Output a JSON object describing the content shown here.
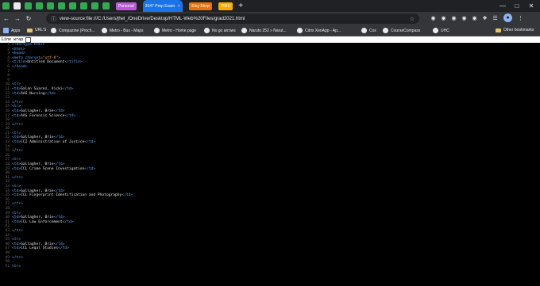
{
  "tabs": [
    {
      "label": "",
      "color": "#34a853"
    },
    {
      "label": "",
      "color": "#e8eaed"
    },
    {
      "label": "",
      "color": "#34a853"
    },
    {
      "label": "",
      "color": "#34a853"
    },
    {
      "label": "",
      "color": "#34a853"
    },
    {
      "label": "",
      "color": "#34a853"
    },
    {
      "label": "",
      "color": "#34a853"
    },
    {
      "label": "",
      "color": "#34a853"
    },
    {
      "label": "",
      "color": "#34a853"
    },
    {
      "label": "",
      "color": "#34a853"
    }
  ],
  "colored_tabs": [
    {
      "label": "Personal",
      "bg": "#b85cd6",
      "active": false
    },
    {
      "label": "3147 Prep Exam",
      "bg": "#1a73e8",
      "active": true
    },
    {
      "label": "Etsy Shop",
      "bg": "#e8710a",
      "active": false
    },
    {
      "label": "TIMU",
      "bg": "#f9ab00",
      "active": false
    }
  ],
  "address": {
    "url": "view-source:file:///C:/Users/jhel_/OneDrive/Desktop/HTML-Web%20Files/grad2021.html"
  },
  "bookmarks": [
    {
      "label": "Apps",
      "kind": "grid"
    },
    {
      "label": "URL'S",
      "kind": "folder"
    },
    {
      "label": "Compazine (Proch...",
      "kind": "site"
    },
    {
      "label": "Metro - Bus - Maps",
      "kind": "site"
    },
    {
      "label": "Metro - Home page",
      "kind": "site"
    },
    {
      "label": "No go arrows",
      "kind": "site"
    },
    {
      "label": "Naruto 252 » Narut...",
      "kind": "site"
    },
    {
      "label": "Citrix XenApp - Ap...",
      "kind": "site"
    },
    {
      "label": "Cox",
      "kind": "site"
    },
    {
      "label": "CourseCompass",
      "kind": "site"
    },
    {
      "label": "UHC",
      "kind": "site"
    },
    {
      "label": "Other bookmarks",
      "kind": "folder"
    }
  ],
  "linewrap": {
    "label": "Line wrap"
  },
  "source_lines": [
    {
      "n": "1",
      "parts": [
        [
          "tag",
          "<!doctype html>"
        ]
      ]
    },
    {
      "n": "2",
      "parts": [
        [
          "tag",
          "<html>"
        ]
      ]
    },
    {
      "n": "3",
      "parts": [
        [
          "tag",
          "<head>"
        ]
      ]
    },
    {
      "n": "4",
      "parts": [
        [
          "tag",
          "<meta charset="
        ],
        [
          "val",
          "\"utf-8\""
        ],
        [
          "tag",
          ">"
        ]
      ]
    },
    {
      "n": "5",
      "parts": [
        [
          "tag",
          "<title>"
        ],
        [
          "txt",
          "Untitled Document"
        ],
        [
          "tag",
          "</title>"
        ]
      ]
    },
    {
      "n": "6",
      "parts": [
        [
          "tag",
          "</head>"
        ]
      ]
    },
    {
      "n": "7",
      "parts": []
    },
    {
      "n": "8",
      "parts": []
    },
    {
      "n": "9",
      "parts": []
    },
    {
      "n": "10",
      "parts": [
        [
          "tag",
          "<tr>"
        ]
      ]
    },
    {
      "n": "11",
      "parts": [
        [
          "tag",
          "<td>"
        ],
        [
          "txt",
          "Galan Suarez, Vicki"
        ],
        [
          "tag",
          "</td>"
        ]
      ]
    },
    {
      "n": "12",
      "parts": [
        [
          "tag",
          "<td>"
        ],
        [
          "txt",
          "AAS Nursing"
        ],
        [
          "tag",
          "</td>"
        ]
      ]
    },
    {
      "n": "13",
      "parts": []
    },
    {
      "n": "14",
      "parts": [
        [
          "tag",
          "</tr>"
        ]
      ]
    },
    {
      "n": "15",
      "parts": [
        [
          "tag",
          "<tr>"
        ]
      ]
    },
    {
      "n": "16",
      "parts": [
        [
          "tag",
          "<td>"
        ],
        [
          "txt",
          "Gallagher, Brie"
        ],
        [
          "tag",
          "</td>"
        ]
      ]
    },
    {
      "n": "17",
      "parts": [
        [
          "tag",
          "<td>"
        ],
        [
          "txt",
          "AAS Forensic Science"
        ],
        [
          "tag",
          "</td>"
        ]
      ]
    },
    {
      "n": "18",
      "parts": []
    },
    {
      "n": "19",
      "parts": [
        [
          "tag",
          "</tr>"
        ]
      ]
    },
    {
      "n": "20",
      "parts": []
    },
    {
      "n": "21",
      "parts": [
        [
          "tag",
          "<tr>"
        ]
      ]
    },
    {
      "n": "22",
      "parts": [
        [
          "tag",
          "<td>"
        ],
        [
          "txt",
          "Gallagher, Brie"
        ],
        [
          "tag",
          "</td>"
        ]
      ]
    },
    {
      "n": "23",
      "parts": [
        [
          "tag",
          "<td>"
        ],
        [
          "txt",
          "CCI Administration of Justice"
        ],
        [
          "tag",
          "</td>"
        ]
      ]
    },
    {
      "n": "24",
      "parts": []
    },
    {
      "n": "25",
      "parts": [
        [
          "tag",
          "</tr>"
        ]
      ]
    },
    {
      "n": "26",
      "parts": []
    },
    {
      "n": "27",
      "parts": [
        [
          "tag",
          "<tr>"
        ]
      ]
    },
    {
      "n": "28",
      "parts": [
        [
          "tag",
          "<td>"
        ],
        [
          "txt",
          "Gallagher, Brie"
        ],
        [
          "tag",
          "</td>"
        ]
      ]
    },
    {
      "n": "29",
      "parts": [
        [
          "tag",
          "<td>"
        ],
        [
          "txt",
          "CCL Crime Scene Investigation"
        ],
        [
          "tag",
          "</td>"
        ]
      ]
    },
    {
      "n": "30",
      "parts": []
    },
    {
      "n": "31",
      "parts": [
        [
          "tag",
          "</tr>"
        ]
      ]
    },
    {
      "n": "32",
      "parts": []
    },
    {
      "n": "33",
      "parts": [
        [
          "tag",
          "<tr>"
        ]
      ]
    },
    {
      "n": "34",
      "parts": [
        [
          "tag",
          "<td>"
        ],
        [
          "txt",
          "Gallagher, Brie"
        ],
        [
          "tag",
          "</td>"
        ]
      ]
    },
    {
      "n": "35",
      "parts": [
        [
          "tag",
          "<td>"
        ],
        [
          "txt",
          "CCL Fingerprint Identification and Photography"
        ],
        [
          "tag",
          "</td>"
        ]
      ]
    },
    {
      "n": "36",
      "parts": []
    },
    {
      "n": "37",
      "parts": [
        [
          "tag",
          "</tr>"
        ]
      ]
    },
    {
      "n": "38",
      "parts": []
    },
    {
      "n": "39",
      "parts": [
        [
          "tag",
          "<tr>"
        ]
      ]
    },
    {
      "n": "40",
      "parts": [
        [
          "tag",
          "<td>"
        ],
        [
          "txt",
          "Gallagher, Brie"
        ],
        [
          "tag",
          "</td>"
        ]
      ]
    },
    {
      "n": "41",
      "parts": [
        [
          "tag",
          "<td>"
        ],
        [
          "txt",
          "CCL Law Enforcement"
        ],
        [
          "tag",
          "</td>"
        ]
      ]
    },
    {
      "n": "42",
      "parts": []
    },
    {
      "n": "43",
      "parts": [
        [
          "tag",
          "</tr>"
        ]
      ]
    },
    {
      "n": "44",
      "parts": []
    },
    {
      "n": "45",
      "parts": [
        [
          "tag",
          "<tr>"
        ]
      ]
    },
    {
      "n": "46",
      "parts": [
        [
          "tag",
          "<td>"
        ],
        [
          "txt",
          "Gallagher, Brie"
        ],
        [
          "tag",
          "</td>"
        ]
      ]
    },
    {
      "n": "47",
      "parts": [
        [
          "tag",
          "<td>"
        ],
        [
          "txt",
          "CCL Legal Studies"
        ],
        [
          "tag",
          "</td>"
        ]
      ]
    },
    {
      "n": "48",
      "parts": []
    },
    {
      "n": "49",
      "parts": [
        [
          "tag",
          "</tr>"
        ]
      ]
    },
    {
      "n": "50",
      "parts": []
    },
    {
      "n": "51",
      "parts": [
        [
          "tag",
          "<tr>"
        ]
      ]
    }
  ]
}
